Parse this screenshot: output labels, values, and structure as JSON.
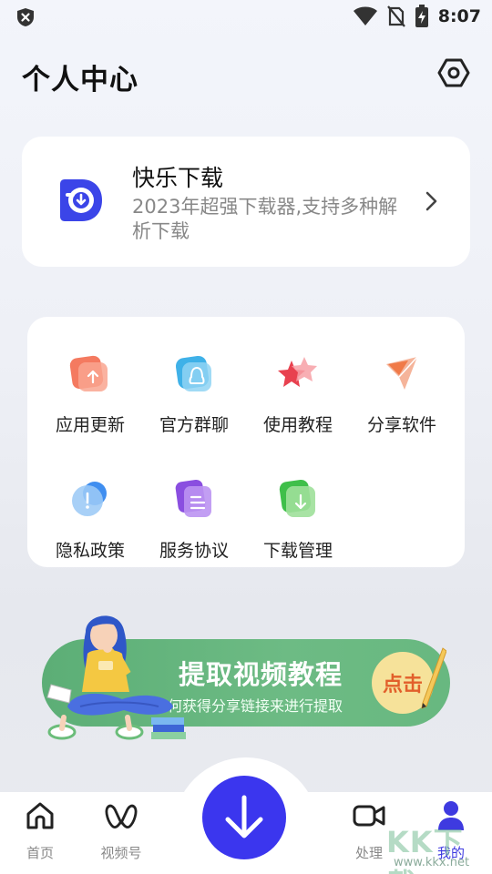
{
  "status_bar": {
    "time": "8:07"
  },
  "header": {
    "title": "个人中心"
  },
  "app_card": {
    "name": "快乐下载",
    "description": "2023年超强下载器,支持多种解析下载"
  },
  "grid": {
    "items": [
      {
        "label": "应用更新",
        "icon": "update-icon"
      },
      {
        "label": "官方群聊",
        "icon": "group-chat-icon"
      },
      {
        "label": "使用教程",
        "icon": "tutorial-star-icon"
      },
      {
        "label": "分享软件",
        "icon": "share-plane-icon"
      },
      {
        "label": "隐私政策",
        "icon": "privacy-icon"
      },
      {
        "label": "服务协议",
        "icon": "agreement-icon"
      },
      {
        "label": "下载管理",
        "icon": "download-manage-icon"
      }
    ]
  },
  "banner": {
    "title": "提取视频教程",
    "subtitle": "如何获得分享链接来进行提取",
    "button": "点击"
  },
  "bottom_nav": {
    "items": [
      {
        "label": "首页",
        "icon": "home-icon"
      },
      {
        "label": "视频号",
        "icon": "video-channel-icon"
      },
      {
        "label": "处理",
        "icon": "video-camera-icon"
      },
      {
        "label": "我的",
        "icon": "profile-icon"
      }
    ],
    "active": "我的"
  },
  "watermark": {
    "logo": "KK下载",
    "url": "www.kkx.net"
  },
  "colors": {
    "accent": "#3b36ee",
    "banner_green": "#5cae76",
    "button_yellow": "#f6e29a"
  }
}
